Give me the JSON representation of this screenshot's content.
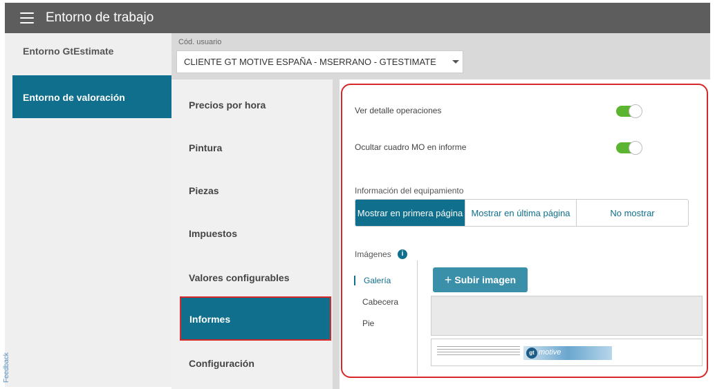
{
  "header": {
    "title": "Entorno de trabajo"
  },
  "left_nav": {
    "items": [
      {
        "label": "Entorno GtEstimate",
        "active": false
      },
      {
        "label": "Entorno de valoración",
        "active": true
      }
    ],
    "feedback": "Feedback"
  },
  "user": {
    "label": "Cód. usuario",
    "value": "CLIENTE GT MOTIVE ESPAÑA - MSERRANO - GTESTIMATE"
  },
  "settings_nav": {
    "items": [
      {
        "label": "Precios por hora",
        "active": false
      },
      {
        "label": "Pintura",
        "active": false
      },
      {
        "label": "Piezas",
        "active": false
      },
      {
        "label": "Impuestos",
        "active": false
      },
      {
        "label": "Valores configurables",
        "active": false
      },
      {
        "label": "Informes",
        "active": true
      },
      {
        "label": "Configuración",
        "active": false
      }
    ]
  },
  "report": {
    "toggles": [
      {
        "label": "Ver detalle operaciones",
        "on": true
      },
      {
        "label": "Ocultar cuadro MO en informe",
        "on": true
      }
    ],
    "equipment": {
      "label": "Información del equipamiento",
      "options": [
        "Mostrar en primera página",
        "Mostrar en última página",
        "No mostrar"
      ],
      "selected": "Mostrar en primera página"
    },
    "images": {
      "label": "Imágenes",
      "info_icon": "info-icon",
      "tabs": [
        "Galería",
        "Cabecera",
        "Pie"
      ],
      "active_tab": "Galería",
      "upload_label": "Subir imagen",
      "logo_text": "motive",
      "logo_mark": "gt"
    }
  },
  "colors": {
    "accent": "#0f6f8c",
    "toggle_on": "#5cb531",
    "highlight": "#d62828",
    "topbar": "#5d5d5d"
  }
}
